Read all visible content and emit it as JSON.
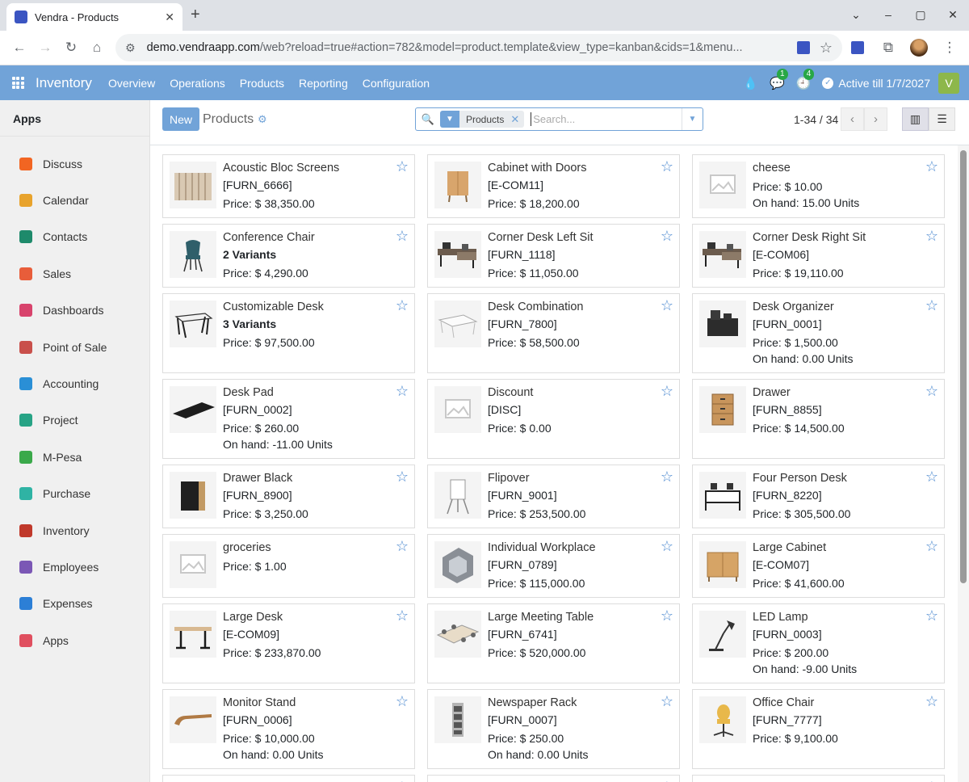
{
  "browser": {
    "tab_title": "Vendra - Products",
    "url_host": "demo.vendraapp.com",
    "url_path": "/web?reload=true#action=782&model=product.template&view_type=kanban&cids=1&menu..."
  },
  "navbar": {
    "brand": "Inventory",
    "menus": [
      "Overview",
      "Operations",
      "Products",
      "Reporting",
      "Configuration"
    ],
    "messages_badge": "1",
    "activities_badge": "4",
    "active_text": "Active till 1/7/2027",
    "avatar_letter": "V"
  },
  "sidebar": {
    "header": "Apps",
    "items": [
      {
        "label": "Discuss",
        "color": "#f26522"
      },
      {
        "label": "Calendar",
        "color": "#e8a32c"
      },
      {
        "label": "Contacts",
        "color": "#1e8a6b"
      },
      {
        "label": "Sales",
        "color": "#e85d3a"
      },
      {
        "label": "Dashboards",
        "color": "#d8436c"
      },
      {
        "label": "Point of Sale",
        "color": "#c9504b"
      },
      {
        "label": "Accounting",
        "color": "#2a8fd6"
      },
      {
        "label": "Project",
        "color": "#27a385"
      },
      {
        "label": "M-Pesa",
        "color": "#3aa94a"
      },
      {
        "label": "Purchase",
        "color": "#2fb3a4"
      },
      {
        "label": "Inventory",
        "color": "#c0392b"
      },
      {
        "label": "Employees",
        "color": "#7b57b5"
      },
      {
        "label": "Expenses",
        "color": "#2c7fd6"
      },
      {
        "label": "Apps",
        "color": "#e04f5f"
      }
    ]
  },
  "control": {
    "new_label": "New",
    "breadcrumb": "Products",
    "facet_label": "Products",
    "search_placeholder": "Search...",
    "pager": "1-34 / 34"
  },
  "products": [
    {
      "name": "Acoustic Bloc Screens",
      "line2": "[FURN_6666]",
      "bold": false,
      "price": "Price: $ 38,350.00",
      "onhand": "",
      "img": "screens"
    },
    {
      "name": "Cabinet with Doors",
      "line2": "[E-COM11]",
      "bold": false,
      "price": "Price: $ 18,200.00",
      "onhand": "",
      "img": "cabinet"
    },
    {
      "name": "cheese",
      "line2": "",
      "bold": false,
      "price": "Price: $ 10.00",
      "onhand": "On hand: 15.00 Units",
      "img": "placeholder"
    },
    {
      "name": "Conference Chair",
      "line2": "2 Variants",
      "bold": true,
      "price": "Price: $ 4,290.00",
      "onhand": "",
      "img": "chair"
    },
    {
      "name": "Corner Desk Left Sit",
      "line2": "[FURN_1118]",
      "bold": false,
      "price": "Price: $ 11,050.00",
      "onhand": "",
      "img": "cornerdesk"
    },
    {
      "name": "Corner Desk Right Sit",
      "line2": "[E-COM06]",
      "bold": false,
      "price": "Price: $ 19,110.00",
      "onhand": "",
      "img": "cornerdesk"
    },
    {
      "name": "Customizable Desk",
      "line2": "3 Variants",
      "bold": true,
      "price": "Price: $ 97,500.00",
      "onhand": "",
      "img": "desk"
    },
    {
      "name": "Desk Combination",
      "line2": "[FURN_7800]",
      "bold": false,
      "price": "Price: $ 58,500.00",
      "onhand": "",
      "img": "deskcombo"
    },
    {
      "name": "Desk Organizer",
      "line2": "[FURN_0001]",
      "bold": false,
      "price": "Price: $ 1,500.00",
      "onhand": "On hand: 0.00 Units",
      "img": "organizer"
    },
    {
      "name": "Desk Pad",
      "line2": "[FURN_0002]",
      "bold": false,
      "price": "Price: $ 260.00",
      "onhand": "On hand: -11.00 Units",
      "img": "deskpad"
    },
    {
      "name": "Discount",
      "line2": "[DISC]",
      "bold": false,
      "price": "Price: $ 0.00",
      "onhand": "",
      "img": "placeholder"
    },
    {
      "name": "Drawer",
      "line2": "[FURN_8855]",
      "bold": false,
      "price": "Price: $ 14,500.00",
      "onhand": "",
      "img": "drawer"
    },
    {
      "name": "Drawer Black",
      "line2": "[FURN_8900]",
      "bold": false,
      "price": "Price: $ 3,250.00",
      "onhand": "",
      "img": "drawerblack"
    },
    {
      "name": "Flipover",
      "line2": "[FURN_9001]",
      "bold": false,
      "price": "Price: $ 253,500.00",
      "onhand": "",
      "img": "flipover"
    },
    {
      "name": "Four Person Desk",
      "line2": "[FURN_8220]",
      "bold": false,
      "price": "Price: $ 305,500.00",
      "onhand": "",
      "img": "fourdesk"
    },
    {
      "name": "groceries",
      "line2": "",
      "bold": false,
      "price": "Price: $ 1.00",
      "onhand": "",
      "img": "placeholder"
    },
    {
      "name": "Individual Workplace",
      "line2": "[FURN_0789]",
      "bold": false,
      "price": "Price: $ 115,000.00",
      "onhand": "",
      "img": "workplace"
    },
    {
      "name": "Large Cabinet",
      "line2": "[E-COM07]",
      "bold": false,
      "price": "Price: $ 41,600.00",
      "onhand": "",
      "img": "largecabinet"
    },
    {
      "name": "Large Desk",
      "line2": "[E-COM09]",
      "bold": false,
      "price": "Price: $ 233,870.00",
      "onhand": "",
      "img": "largedesk"
    },
    {
      "name": "Large Meeting Table",
      "line2": "[FURN_6741]",
      "bold": false,
      "price": "Price: $ 520,000.00",
      "onhand": "",
      "img": "meetingtable"
    },
    {
      "name": "LED Lamp",
      "line2": "[FURN_0003]",
      "bold": false,
      "price": "Price: $ 200.00",
      "onhand": "On hand: -9.00 Units",
      "img": "lamp"
    },
    {
      "name": "Monitor Stand",
      "line2": "[FURN_0006]",
      "bold": false,
      "price": "Price: $ 10,000.00",
      "onhand": "On hand: 0.00 Units",
      "img": "monitorstand"
    },
    {
      "name": "Newspaper Rack",
      "line2": "[FURN_0007]",
      "bold": false,
      "price": "Price: $ 250.00",
      "onhand": "On hand: 0.00 Units",
      "img": "rack"
    },
    {
      "name": "Office Chair",
      "line2": "[FURN_7777]",
      "bold": false,
      "price": "Price: $ 9,100.00",
      "onhand": "",
      "img": "officechair"
    }
  ]
}
